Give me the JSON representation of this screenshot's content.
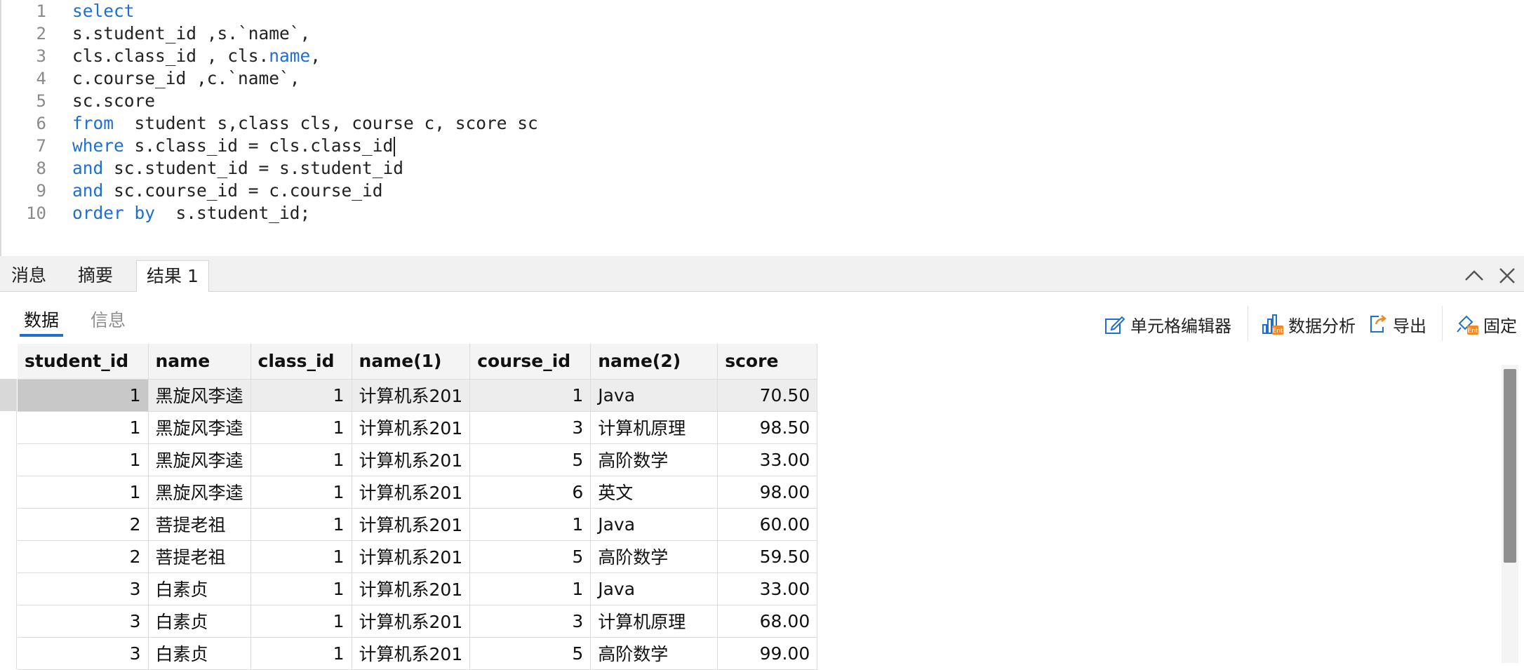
{
  "editor": {
    "lines": [
      {
        "no": "1",
        "segments": [
          {
            "t": "select",
            "k": true
          }
        ]
      },
      {
        "no": "2",
        "segments": [
          {
            "t": "s.student_id ,s.`name`,",
            "k": false
          }
        ]
      },
      {
        "no": "3",
        "segments": [
          {
            "t": "cls.class_id , cls.",
            "k": false
          },
          {
            "t": "name",
            "k": true
          },
          {
            "t": ",",
            "k": false
          }
        ]
      },
      {
        "no": "4",
        "segments": [
          {
            "t": "c.course_id ,c.`name`,",
            "k": false
          }
        ]
      },
      {
        "no": "5",
        "segments": [
          {
            "t": "sc.score",
            "k": false
          }
        ]
      },
      {
        "no": "6",
        "segments": [
          {
            "t": "from",
            "k": true
          },
          {
            "t": "  student s,class cls, course c, score sc",
            "k": false
          }
        ]
      },
      {
        "no": "7",
        "segments": [
          {
            "t": "where",
            "k": true
          },
          {
            "t": " s.class_id = cls.class_id",
            "k": false
          }
        ],
        "caret": true
      },
      {
        "no": "8",
        "segments": [
          {
            "t": "and",
            "k": true
          },
          {
            "t": " sc.student_id = s.student_id",
            "k": false
          }
        ]
      },
      {
        "no": "9",
        "segments": [
          {
            "t": "and",
            "k": true
          },
          {
            "t": " sc.course_id = c.course_id",
            "k": false
          }
        ]
      },
      {
        "no": "10",
        "segments": [
          {
            "t": "order by",
            "k": true
          },
          {
            "t": "  s.student_id;",
            "k": false
          }
        ]
      }
    ]
  },
  "result_tabs": {
    "messages": "消息",
    "summary": "摘要",
    "result1": "结果 1"
  },
  "sub_tabs": {
    "data": "数据",
    "info": "信息"
  },
  "toolbar": {
    "cell_editor": "单元格编辑器",
    "data_analysis": "数据分析",
    "export": "导出",
    "pin": "固定"
  },
  "colors": {
    "keyword": "#1f6fd1",
    "accent": "#1f6fd1"
  },
  "table": {
    "columns": [
      "student_id",
      "name",
      "class_id",
      "name(1)",
      "course_id",
      "name(2)",
      "score"
    ],
    "numeric": [
      true,
      false,
      true,
      false,
      true,
      false,
      true
    ],
    "rows": [
      [
        "1",
        "黑旋风李逵",
        "1",
        "计算机系201",
        "1",
        "Java",
        "70.50"
      ],
      [
        "1",
        "黑旋风李逵",
        "1",
        "计算机系201",
        "3",
        "计算机原理",
        "98.50"
      ],
      [
        "1",
        "黑旋风李逵",
        "1",
        "计算机系201",
        "5",
        "高阶数学",
        "33.00"
      ],
      [
        "1",
        "黑旋风李逵",
        "1",
        "计算机系201",
        "6",
        "英文",
        "98.00"
      ],
      [
        "2",
        "菩提老祖",
        "1",
        "计算机系201",
        "1",
        "Java",
        "60.00"
      ],
      [
        "2",
        "菩提老祖",
        "1",
        "计算机系201",
        "5",
        "高阶数学",
        "59.50"
      ],
      [
        "3",
        "白素贞",
        "1",
        "计算机系201",
        "1",
        "Java",
        "33.00"
      ],
      [
        "3",
        "白素贞",
        "1",
        "计算机系201",
        "3",
        "计算机原理",
        "68.00"
      ],
      [
        "3",
        "白素贞",
        "1",
        "计算机系201",
        "5",
        "高阶数学",
        "99.00"
      ]
    ]
  }
}
